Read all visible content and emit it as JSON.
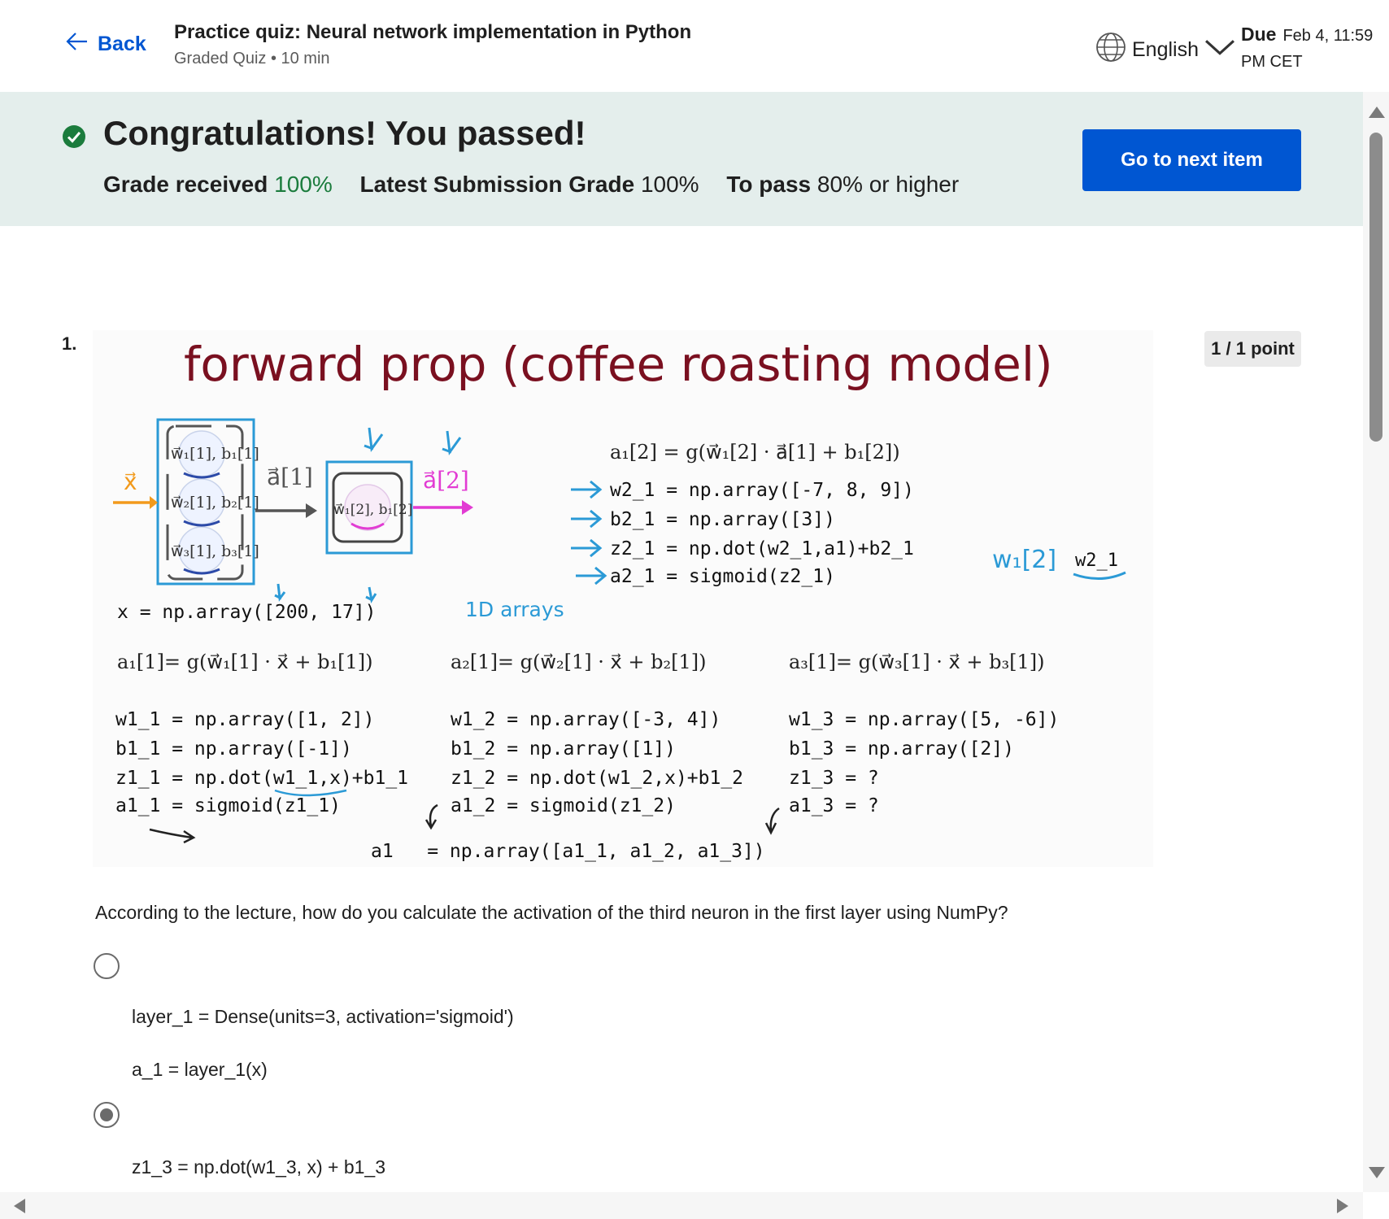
{
  "header": {
    "back_label": "Back",
    "title": "Practice quiz: Neural network implementation in Python",
    "meta": "Graded Quiz • 10 min",
    "language": "English",
    "due_label": "Due",
    "due_value_line1": "Feb 4, 11:59",
    "due_value_line2": "PM CET"
  },
  "banner": {
    "headline": "Congratulations! You passed!",
    "grade_received_label": "Grade received",
    "grade_received_value": "100%",
    "latest_label": "Latest Submission Grade",
    "latest_value": "100%",
    "to_pass_label": "To pass",
    "to_pass_value": "80% or higher",
    "next_button": "Go to next item"
  },
  "question": {
    "number": "1.",
    "points": "1 / 1 point",
    "text": "According to the lecture, how do you calculate the activation of the third neuron in the first layer using NumPy?",
    "options": [
      {
        "lines": [
          "layer_1 = Dense(units=3, activation='sigmoid')",
          "a_1 = layer_1(x)"
        ],
        "selected": false
      },
      {
        "lines": [
          "z1_3 = np.dot(w1_3, x) + b1_3"
        ],
        "selected": true
      }
    ]
  },
  "figure": {
    "title": "forward prop (coffee roasting model)",
    "x_label": "x⃗",
    "a1_label": "a⃗[1]",
    "a2_label": "a⃗[2]",
    "neuron1": "w⃗₁[1], b₁[1]",
    "neuron2": "w⃗₂[1], b₂[1]",
    "neuron3": "w⃗₃[1], b₃[1]",
    "layer2_neuron": "w⃗₁[2], b₁[2]",
    "eq_layer2": "a₁[2] = g(w⃗₁[2] · a⃗[1] + b₁[2])",
    "code_layer2": [
      "w2_1 = np.array([-7, 8, 9])",
      "b2_1 = np.array([3])",
      "z2_1 = np.dot(w2_1,a1)+b2_1",
      "a2_1 = sigmoid(z2_1)"
    ],
    "note_w": "w₁[2]",
    "note_w_code": "w2_1",
    "x_code": "x = np.array([200, 17])",
    "note_1d": "1D arrays",
    "eq_n1": "a₁[1]= g(w⃗₁[1] · x⃗ + b₁[1])",
    "eq_n2": "a₂[1]= g(w⃗₂[1] · x⃗ + b₂[1])",
    "eq_n3": "a₃[1]= g(w⃗₃[1] · x⃗ + b₃[1])",
    "code_n1": [
      "w1_1 = np.array([1, 2])",
      "b1_1 = np.array([-1])",
      "z1_1 = np.dot(w1_1,x)+b1_1",
      "a1_1 = sigmoid(z1_1)"
    ],
    "code_n2": [
      "w1_2 = np.array([-3, 4])",
      "b1_2 = np.array([1])",
      "z1_2 = np.dot(w1_2,x)+b1_2",
      "a1_2 = sigmoid(z1_2)"
    ],
    "code_n3": [
      "w1_3 = np.array([5, -6])",
      "b1_3 = np.array([2])",
      "z1_3 = ?",
      "a1_3 = ?"
    ],
    "code_a1": "a1   = np.array([a1_1, a1_2, a1_3])"
  },
  "colors": {
    "accent": "#0056d2",
    "pass_green": "#1b7c3d",
    "title_maroon": "#7a1020",
    "annot_blue": "#2b9ad6",
    "magenta": "#e23bd3",
    "orange": "#f29a1c"
  }
}
